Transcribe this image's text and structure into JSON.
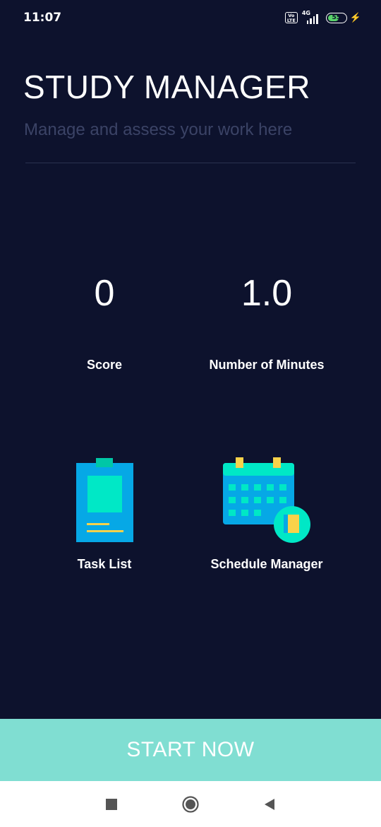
{
  "status_bar": {
    "time": "11:07",
    "volte": "Vo LTE",
    "network": "4G",
    "battery_level": "55"
  },
  "app": {
    "title": "STUDY MANAGER",
    "subtitle": "Manage and assess your work here"
  },
  "stats": {
    "score_value": "0",
    "score_label": "Score",
    "minutes_value": "1.0",
    "minutes_label": "Number of Minutes"
  },
  "features": {
    "task_list_label": "Task List",
    "schedule_label": "Schedule Manager"
  },
  "start_button": {
    "label": "START NOW"
  },
  "nav": {
    "recent_icon": "square-icon",
    "home_icon": "circle-icon",
    "back_icon": "triangle-back-icon"
  },
  "colors": {
    "background": "#0d122d",
    "accent": "#80ded2",
    "teal": "#00e8c6",
    "blue": "#06a8e6",
    "yellow": "#f8d24a"
  }
}
